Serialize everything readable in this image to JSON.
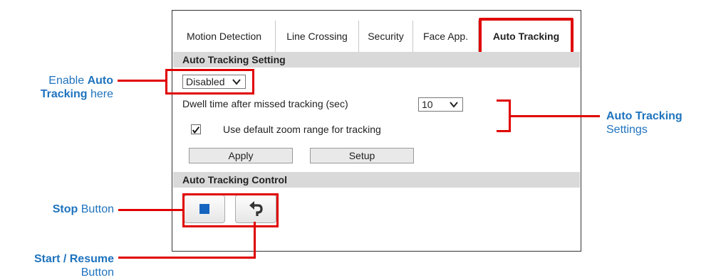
{
  "tabs": [
    {
      "label": "Motion Detection"
    },
    {
      "label": "Line Crossing"
    },
    {
      "label": "Security"
    },
    {
      "label": "Face App."
    },
    {
      "label": "Auto Tracking",
      "active": true
    }
  ],
  "settings": {
    "header": "Auto Tracking Setting",
    "enable_select": "Disabled",
    "dwell_label": "Dwell time after missed tracking (sec)",
    "dwell_value": "10",
    "zoom_checkbox_label": "Use default zoom range for tracking",
    "zoom_checked": true,
    "apply_label": "Apply",
    "setup_label": "Setup"
  },
  "control": {
    "header": "Auto Tracking Control",
    "stop_icon": "stop-square-icon",
    "resume_icon": "undo-arrow-icon"
  },
  "annotations": {
    "enable_line1_prefix": "Enable ",
    "enable_line1_bold": "Auto",
    "enable_line2_bold": "Tracking",
    "enable_line2_suffix": " here",
    "settings_bold": "Auto Tracking",
    "settings_text": "Settings",
    "stop_bold": "Stop",
    "stop_text": " Button",
    "resume_bold": "Start / Resume",
    "resume_text": "Button"
  },
  "colors": {
    "annotation_red": "#e00000",
    "annotation_blue": "#1e73be",
    "stop_blue": "#1565c0",
    "header_gray": "#d9d9d9"
  }
}
